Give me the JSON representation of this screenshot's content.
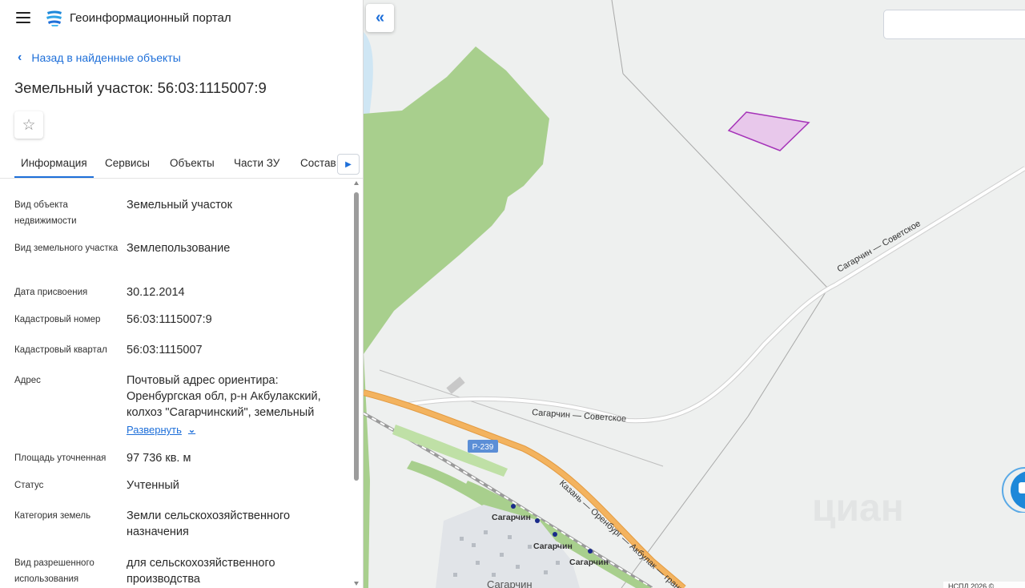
{
  "header": {
    "portal_title": "Геоинформационный портал",
    "menu_icon": "hamburger-menu-icon",
    "logo_icon": "portal-logo-icon"
  },
  "navigation": {
    "back_label": "Назад в найденные объекты"
  },
  "object": {
    "title": "Земельный участок: 56:03:1115007:9",
    "favorite_icon": "star-outline-icon"
  },
  "tabs": [
    {
      "label": "Информация",
      "active": true
    },
    {
      "label": "Сервисы",
      "active": false
    },
    {
      "label": "Объекты",
      "active": false
    },
    {
      "label": "Части ЗУ",
      "active": false
    },
    {
      "label": "Состав",
      "active": false
    }
  ],
  "fields": [
    {
      "label": "Вид объекта недвижимости",
      "value": "Земельный участок"
    },
    {
      "label": "Вид земельного участка",
      "value": "Землепользование"
    },
    {
      "label": "Дата присвоения",
      "value": "30.12.2014"
    },
    {
      "label": "Кадастровый номер",
      "value": "56:03:1115007:9"
    },
    {
      "label": "Кадастровый квартал",
      "value": "56:03:1115007"
    },
    {
      "label": "Адрес",
      "value": "Почтовый адрес ориентира: Оренбургская обл, р-н Акбулакский, колхоз \"Сагарчинский\", земельный",
      "expand_label": "Развернуть"
    },
    {
      "label": "Площадь уточненная",
      "value": "97 736 кв. м"
    },
    {
      "label": "Статус",
      "value": "Учтенный"
    },
    {
      "label": "Категория земель",
      "value": "Земли сельскохозяйственного назначения"
    },
    {
      "label": "Вид разрешенного использования",
      "value": "для сельскохозяйственного производства"
    }
  ],
  "map": {
    "collapse_icon": "double-chevron-left-icon",
    "labels": {
      "road_sagarchin_sovetskoe_1": "Сагарчин — Советское",
      "road_sagarchin_sovetskoe_2": "Сагарчин — Советское",
      "highway_badge": "Р-239",
      "highway_name": "Казань — Оренбург — Акбулак — граница",
      "station_1": "Сагарчин",
      "station_2": "Сагарчин",
      "station_3": "Сагарчин",
      "village": "Сагарчин",
      "watermark": "циан"
    },
    "copyright": "НСПД 2026 ©",
    "colors": {
      "background": "#eef0ef",
      "forest": "#a8cf8d",
      "highway": "#f3b35f",
      "parcel_fill": "#e8c8eb",
      "parcel_stroke": "#a532b8",
      "accent": "#1e6fd9"
    }
  }
}
